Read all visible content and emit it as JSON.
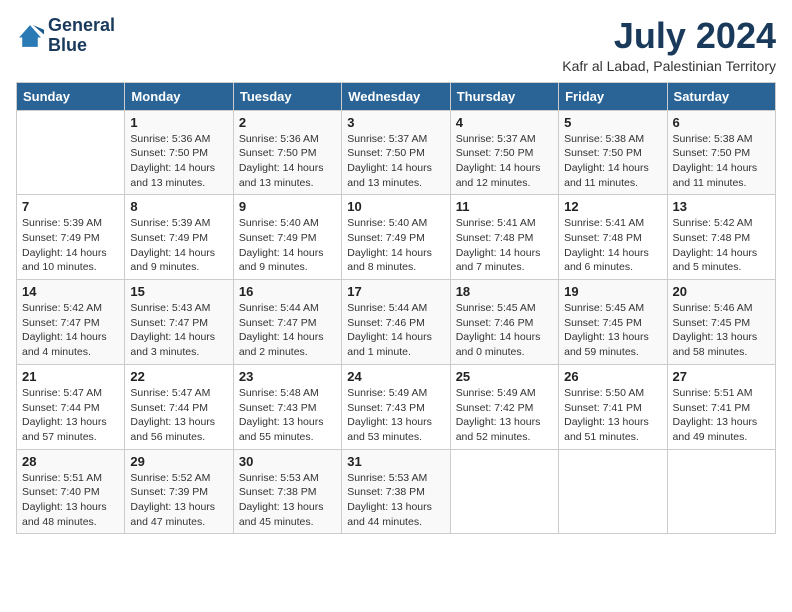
{
  "logo": {
    "line1": "General",
    "line2": "Blue"
  },
  "title": "July 2024",
  "location": "Kafr al Labad, Palestinian Territory",
  "days_header": [
    "Sunday",
    "Monday",
    "Tuesday",
    "Wednesday",
    "Thursday",
    "Friday",
    "Saturday"
  ],
  "weeks": [
    [
      {
        "day": "",
        "info": ""
      },
      {
        "day": "1",
        "info": "Sunrise: 5:36 AM\nSunset: 7:50 PM\nDaylight: 14 hours\nand 13 minutes."
      },
      {
        "day": "2",
        "info": "Sunrise: 5:36 AM\nSunset: 7:50 PM\nDaylight: 14 hours\nand 13 minutes."
      },
      {
        "day": "3",
        "info": "Sunrise: 5:37 AM\nSunset: 7:50 PM\nDaylight: 14 hours\nand 13 minutes."
      },
      {
        "day": "4",
        "info": "Sunrise: 5:37 AM\nSunset: 7:50 PM\nDaylight: 14 hours\nand 12 minutes."
      },
      {
        "day": "5",
        "info": "Sunrise: 5:38 AM\nSunset: 7:50 PM\nDaylight: 14 hours\nand 11 minutes."
      },
      {
        "day": "6",
        "info": "Sunrise: 5:38 AM\nSunset: 7:50 PM\nDaylight: 14 hours\nand 11 minutes."
      }
    ],
    [
      {
        "day": "7",
        "info": "Sunrise: 5:39 AM\nSunset: 7:49 PM\nDaylight: 14 hours\nand 10 minutes."
      },
      {
        "day": "8",
        "info": "Sunrise: 5:39 AM\nSunset: 7:49 PM\nDaylight: 14 hours\nand 9 minutes."
      },
      {
        "day": "9",
        "info": "Sunrise: 5:40 AM\nSunset: 7:49 PM\nDaylight: 14 hours\nand 9 minutes."
      },
      {
        "day": "10",
        "info": "Sunrise: 5:40 AM\nSunset: 7:49 PM\nDaylight: 14 hours\nand 8 minutes."
      },
      {
        "day": "11",
        "info": "Sunrise: 5:41 AM\nSunset: 7:48 PM\nDaylight: 14 hours\nand 7 minutes."
      },
      {
        "day": "12",
        "info": "Sunrise: 5:41 AM\nSunset: 7:48 PM\nDaylight: 14 hours\nand 6 minutes."
      },
      {
        "day": "13",
        "info": "Sunrise: 5:42 AM\nSunset: 7:48 PM\nDaylight: 14 hours\nand 5 minutes."
      }
    ],
    [
      {
        "day": "14",
        "info": "Sunrise: 5:42 AM\nSunset: 7:47 PM\nDaylight: 14 hours\nand 4 minutes."
      },
      {
        "day": "15",
        "info": "Sunrise: 5:43 AM\nSunset: 7:47 PM\nDaylight: 14 hours\nand 3 minutes."
      },
      {
        "day": "16",
        "info": "Sunrise: 5:44 AM\nSunset: 7:47 PM\nDaylight: 14 hours\nand 2 minutes."
      },
      {
        "day": "17",
        "info": "Sunrise: 5:44 AM\nSunset: 7:46 PM\nDaylight: 14 hours\nand 1 minute."
      },
      {
        "day": "18",
        "info": "Sunrise: 5:45 AM\nSunset: 7:46 PM\nDaylight: 14 hours\nand 0 minutes."
      },
      {
        "day": "19",
        "info": "Sunrise: 5:45 AM\nSunset: 7:45 PM\nDaylight: 13 hours\nand 59 minutes."
      },
      {
        "day": "20",
        "info": "Sunrise: 5:46 AM\nSunset: 7:45 PM\nDaylight: 13 hours\nand 58 minutes."
      }
    ],
    [
      {
        "day": "21",
        "info": "Sunrise: 5:47 AM\nSunset: 7:44 PM\nDaylight: 13 hours\nand 57 minutes."
      },
      {
        "day": "22",
        "info": "Sunrise: 5:47 AM\nSunset: 7:44 PM\nDaylight: 13 hours\nand 56 minutes."
      },
      {
        "day": "23",
        "info": "Sunrise: 5:48 AM\nSunset: 7:43 PM\nDaylight: 13 hours\nand 55 minutes."
      },
      {
        "day": "24",
        "info": "Sunrise: 5:49 AM\nSunset: 7:43 PM\nDaylight: 13 hours\nand 53 minutes."
      },
      {
        "day": "25",
        "info": "Sunrise: 5:49 AM\nSunset: 7:42 PM\nDaylight: 13 hours\nand 52 minutes."
      },
      {
        "day": "26",
        "info": "Sunrise: 5:50 AM\nSunset: 7:41 PM\nDaylight: 13 hours\nand 51 minutes."
      },
      {
        "day": "27",
        "info": "Sunrise: 5:51 AM\nSunset: 7:41 PM\nDaylight: 13 hours\nand 49 minutes."
      }
    ],
    [
      {
        "day": "28",
        "info": "Sunrise: 5:51 AM\nSunset: 7:40 PM\nDaylight: 13 hours\nand 48 minutes."
      },
      {
        "day": "29",
        "info": "Sunrise: 5:52 AM\nSunset: 7:39 PM\nDaylight: 13 hours\nand 47 minutes."
      },
      {
        "day": "30",
        "info": "Sunrise: 5:53 AM\nSunset: 7:38 PM\nDaylight: 13 hours\nand 45 minutes."
      },
      {
        "day": "31",
        "info": "Sunrise: 5:53 AM\nSunset: 7:38 PM\nDaylight: 13 hours\nand 44 minutes."
      },
      {
        "day": "",
        "info": ""
      },
      {
        "day": "",
        "info": ""
      },
      {
        "day": "",
        "info": ""
      }
    ]
  ]
}
